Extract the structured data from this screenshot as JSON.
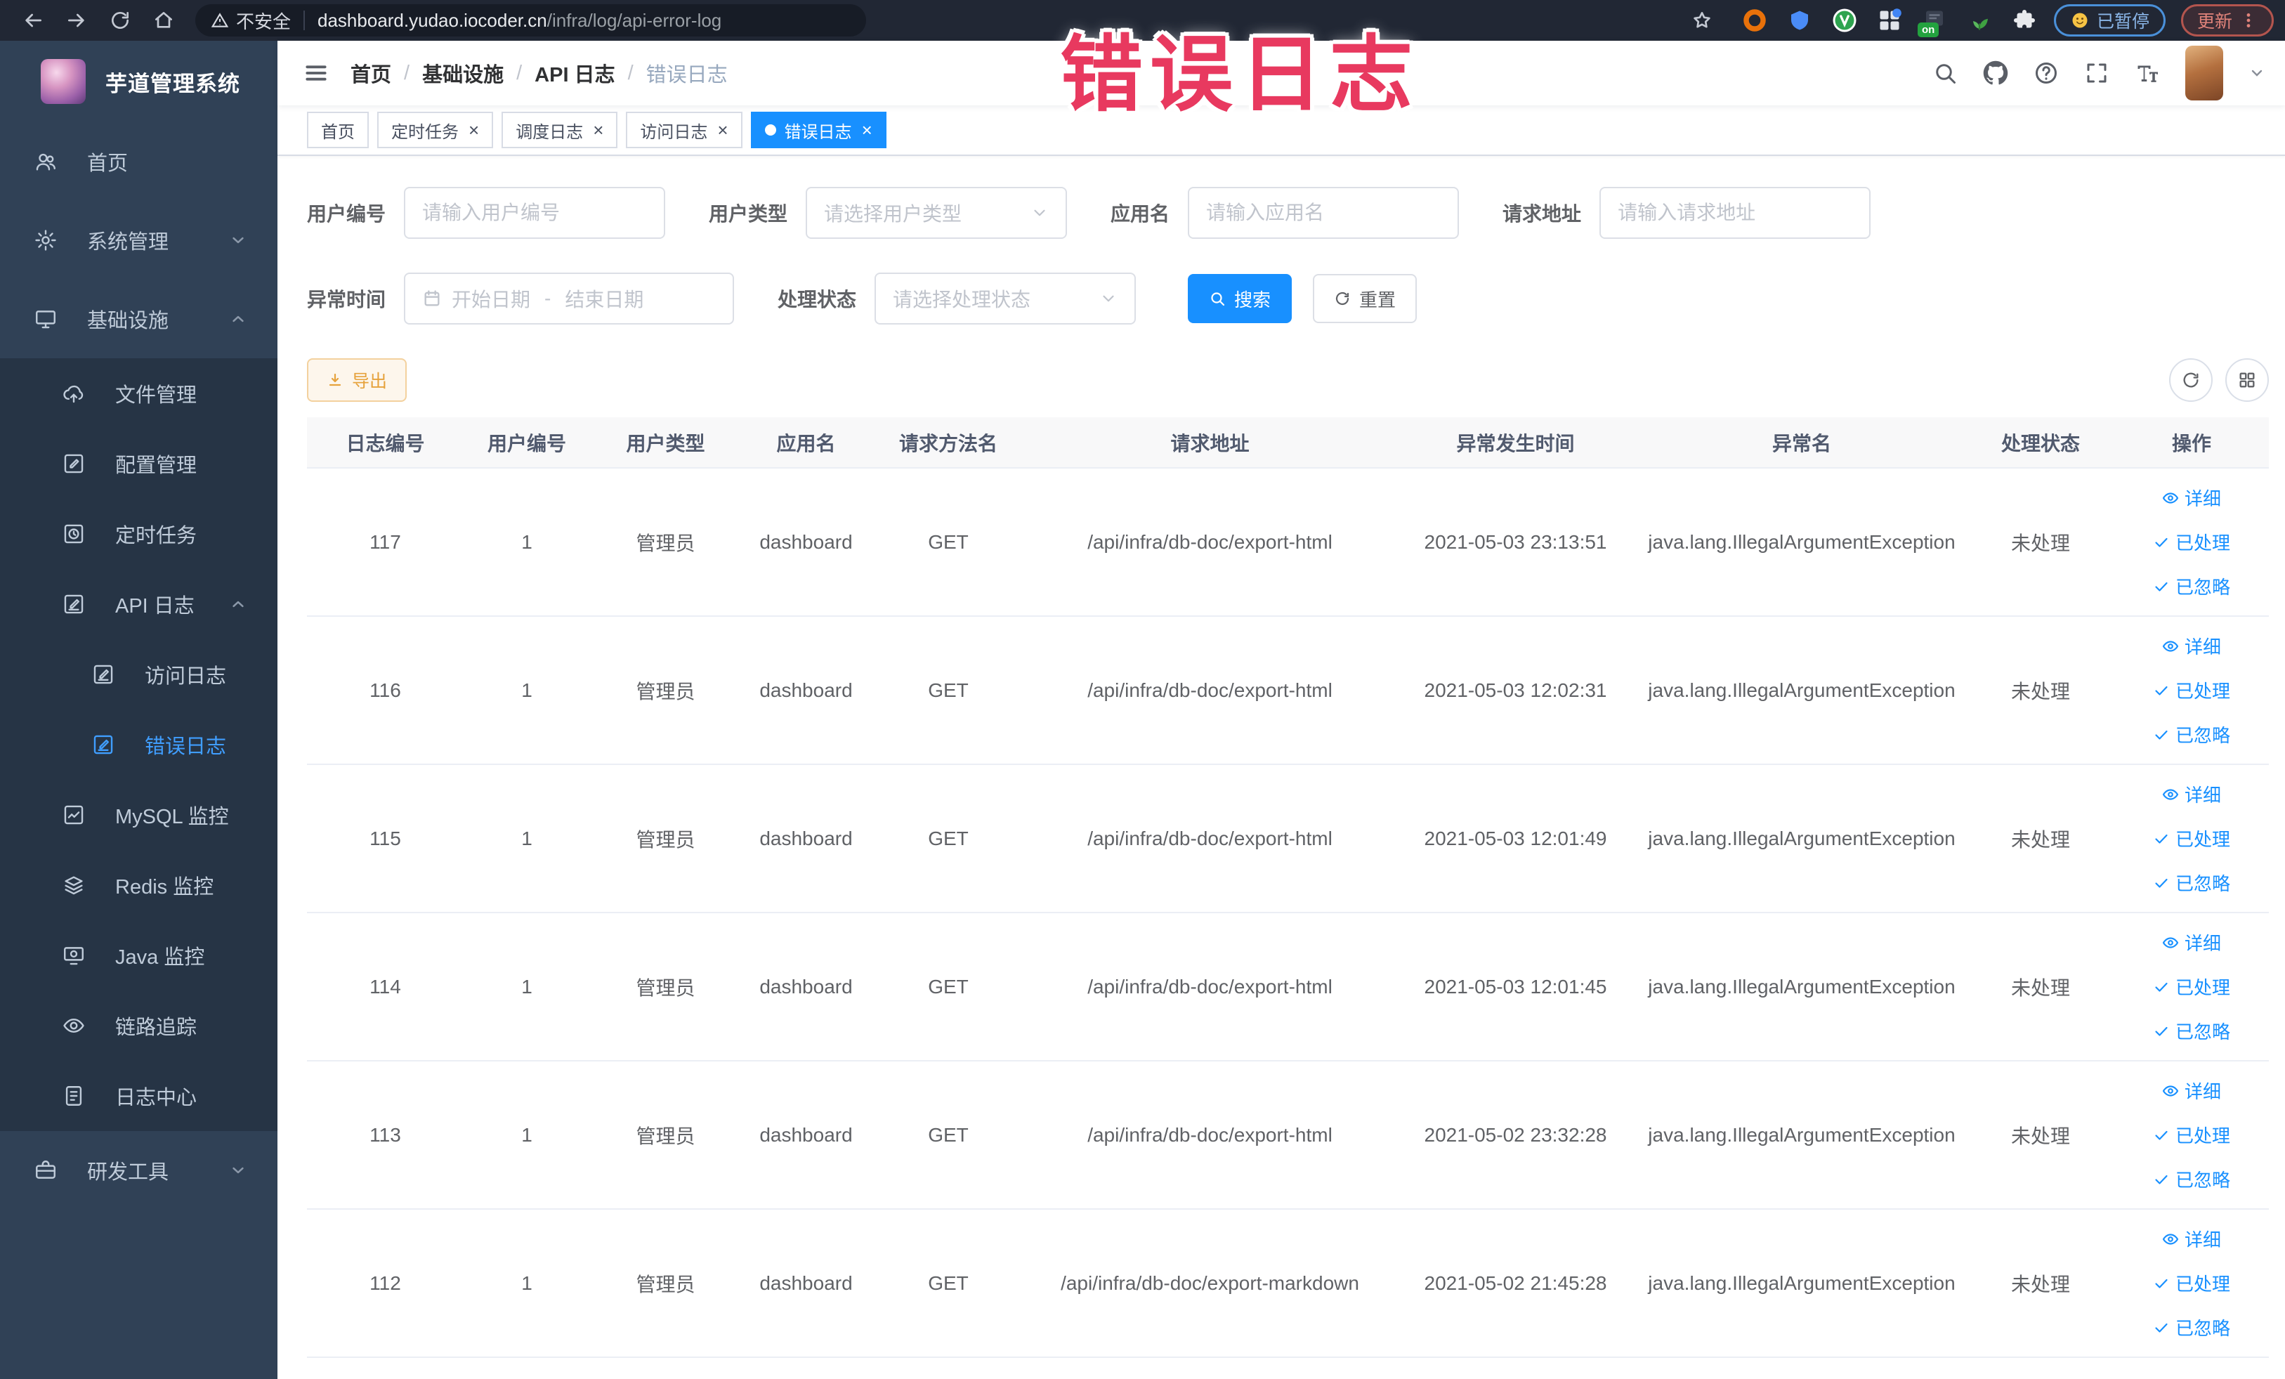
{
  "browser": {
    "security_label": "不安全",
    "url_domain": "dashboard.yudao.iocoder.cn",
    "url_path": "/infra/log/api-error-log",
    "extension_on_badge": "on",
    "paused_label": "已暂停",
    "update_label": "更新"
  },
  "overlay": {
    "text": "错误日志",
    "color": "#e8395f"
  },
  "app": {
    "title": "芋道管理系统"
  },
  "sidebar": {
    "items": [
      {
        "name": "home",
        "label": "首页",
        "icon": "people",
        "level": 0
      },
      {
        "name": "system-management",
        "label": "系统管理",
        "icon": "gear",
        "level": 0,
        "chevron": "down"
      },
      {
        "name": "infrastructure",
        "label": "基础设施",
        "icon": "monitor",
        "level": 0,
        "chevron": "up"
      },
      {
        "name": "file-management",
        "label": "文件管理",
        "icon": "cloud-upload",
        "level": 1
      },
      {
        "name": "config-management",
        "label": "配置管理",
        "icon": "edit-square",
        "level": 1
      },
      {
        "name": "scheduled-tasks",
        "label": "定时任务",
        "icon": "timer",
        "level": 1
      },
      {
        "name": "api-log",
        "label": "API 日志",
        "icon": "log-edit",
        "level": 1,
        "chevron": "up"
      },
      {
        "name": "access-log",
        "label": "访问日志",
        "icon": "log-edit",
        "level": 2
      },
      {
        "name": "error-log",
        "label": "错误日志",
        "icon": "log-edit",
        "level": 2,
        "active": true
      },
      {
        "name": "mysql-monitor",
        "label": "MySQL 监控",
        "icon": "chart",
        "level": 1
      },
      {
        "name": "redis-monitor",
        "label": "Redis 监控",
        "icon": "layers",
        "level": 1
      },
      {
        "name": "java-monitor",
        "label": "Java 监控",
        "icon": "screen",
        "level": 1
      },
      {
        "name": "trace",
        "label": "链路追踪",
        "icon": "eye",
        "level": 1
      },
      {
        "name": "log-center",
        "label": "日志中心",
        "icon": "doc",
        "level": 1
      },
      {
        "name": "dev-tools",
        "label": "研发工具",
        "icon": "briefcase",
        "level": 0,
        "chevron": "down"
      }
    ]
  },
  "breadcrumb": {
    "items": [
      "首页",
      "基础设施",
      "API 日志",
      "错误日志"
    ],
    "separator": "/"
  },
  "tabs": [
    {
      "label": "首页",
      "closable": false,
      "active": false
    },
    {
      "label": "定时任务",
      "closable": true,
      "active": false
    },
    {
      "label": "调度日志",
      "closable": true,
      "active": false
    },
    {
      "label": "访问日志",
      "closable": true,
      "active": false
    },
    {
      "label": "错误日志",
      "closable": true,
      "active": true
    }
  ],
  "filters": {
    "user_id": {
      "label": "用户编号",
      "placeholder": "请输入用户编号"
    },
    "user_type": {
      "label": "用户类型",
      "placeholder": "请选择用户类型"
    },
    "app_name": {
      "label": "应用名",
      "placeholder": "请输入应用名"
    },
    "request_url": {
      "label": "请求地址",
      "placeholder": "请输入请求地址"
    },
    "error_time": {
      "label": "异常时间",
      "start_placeholder": "开始日期",
      "separator": "-",
      "end_placeholder": "结束日期"
    },
    "process_status": {
      "label": "处理状态",
      "placeholder": "请选择处理状态"
    },
    "search_label": "搜索",
    "reset_label": "重置"
  },
  "toolbar": {
    "export_label": "导出"
  },
  "table": {
    "columns": [
      "日志编号",
      "用户编号",
      "用户类型",
      "应用名",
      "请求方法名",
      "请求地址",
      "异常发生时间",
      "异常名",
      "处理状态",
      "操作"
    ],
    "row_actions": [
      "详细",
      "已处理",
      "已忽略"
    ],
    "rows": [
      {
        "id": "117",
        "user_id": "1",
        "user_type": "管理员",
        "app": "dashboard",
        "method": "GET",
        "url": "/api/infra/db-doc/export-html",
        "time": "2021-05-03 23:13:51",
        "exception": "java.lang.IllegalArgumentException",
        "status": "未处理"
      },
      {
        "id": "116",
        "user_id": "1",
        "user_type": "管理员",
        "app": "dashboard",
        "method": "GET",
        "url": "/api/infra/db-doc/export-html",
        "time": "2021-05-03 12:02:31",
        "exception": "java.lang.IllegalArgumentException",
        "status": "未处理"
      },
      {
        "id": "115",
        "user_id": "1",
        "user_type": "管理员",
        "app": "dashboard",
        "method": "GET",
        "url": "/api/infra/db-doc/export-html",
        "time": "2021-05-03 12:01:49",
        "exception": "java.lang.IllegalArgumentException",
        "status": "未处理"
      },
      {
        "id": "114",
        "user_id": "1",
        "user_type": "管理员",
        "app": "dashboard",
        "method": "GET",
        "url": "/api/infra/db-doc/export-html",
        "time": "2021-05-03 12:01:45",
        "exception": "java.lang.IllegalArgumentException",
        "status": "未处理"
      },
      {
        "id": "113",
        "user_id": "1",
        "user_type": "管理员",
        "app": "dashboard",
        "method": "GET",
        "url": "/api/infra/db-doc/export-html",
        "time": "2021-05-02 23:32:28",
        "exception": "java.lang.IllegalArgumentException",
        "status": "未处理"
      },
      {
        "id": "112",
        "user_id": "1",
        "user_type": "管理员",
        "app": "dashboard",
        "method": "GET",
        "url": "/api/infra/db-doc/export-markdown",
        "time": "2021-05-02 21:45:28",
        "exception": "java.lang.IllegalArgumentException",
        "status": "未处理"
      }
    ]
  },
  "colors": {
    "primary": "#1890ff",
    "warning": "#e6a23c",
    "sidebar_bg": "#304156",
    "sidebar_submenu_bg": "#263445",
    "active_menu": "#409eff",
    "annotation": "#e8395f"
  }
}
